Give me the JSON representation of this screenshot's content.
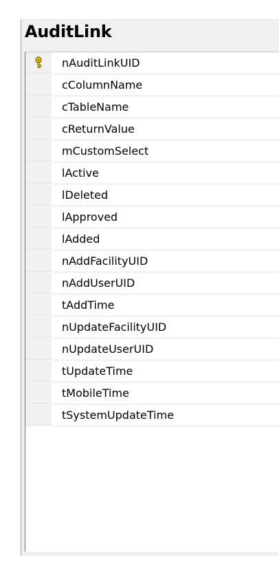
{
  "table": {
    "title": "AuditLink",
    "columns": [
      {
        "name": "nAuditLinkUID",
        "primary_key": true
      },
      {
        "name": "cColumnName",
        "primary_key": false
      },
      {
        "name": "cTableName",
        "primary_key": false
      },
      {
        "name": "cReturnValue",
        "primary_key": false
      },
      {
        "name": "mCustomSelect",
        "primary_key": false
      },
      {
        "name": "lActive",
        "primary_key": false
      },
      {
        "name": "lDeleted",
        "primary_key": false
      },
      {
        "name": "lApproved",
        "primary_key": false
      },
      {
        "name": "lAdded",
        "primary_key": false
      },
      {
        "name": "nAddFacilityUID",
        "primary_key": false
      },
      {
        "name": "nAddUserUID",
        "primary_key": false
      },
      {
        "name": "tAddTime",
        "primary_key": false
      },
      {
        "name": "nUpdateFacilityUID",
        "primary_key": false
      },
      {
        "name": "nUpdateUserUID",
        "primary_key": false
      },
      {
        "name": "tUpdateTime",
        "primary_key": false
      },
      {
        "name": "tMobileTime",
        "primary_key": false
      },
      {
        "name": "tSystemUpdateTime",
        "primary_key": false
      }
    ]
  },
  "icons": {
    "primary_key": "key-icon"
  },
  "colors": {
    "key_fill": "#f2d200",
    "key_outline": "#6b5500"
  }
}
